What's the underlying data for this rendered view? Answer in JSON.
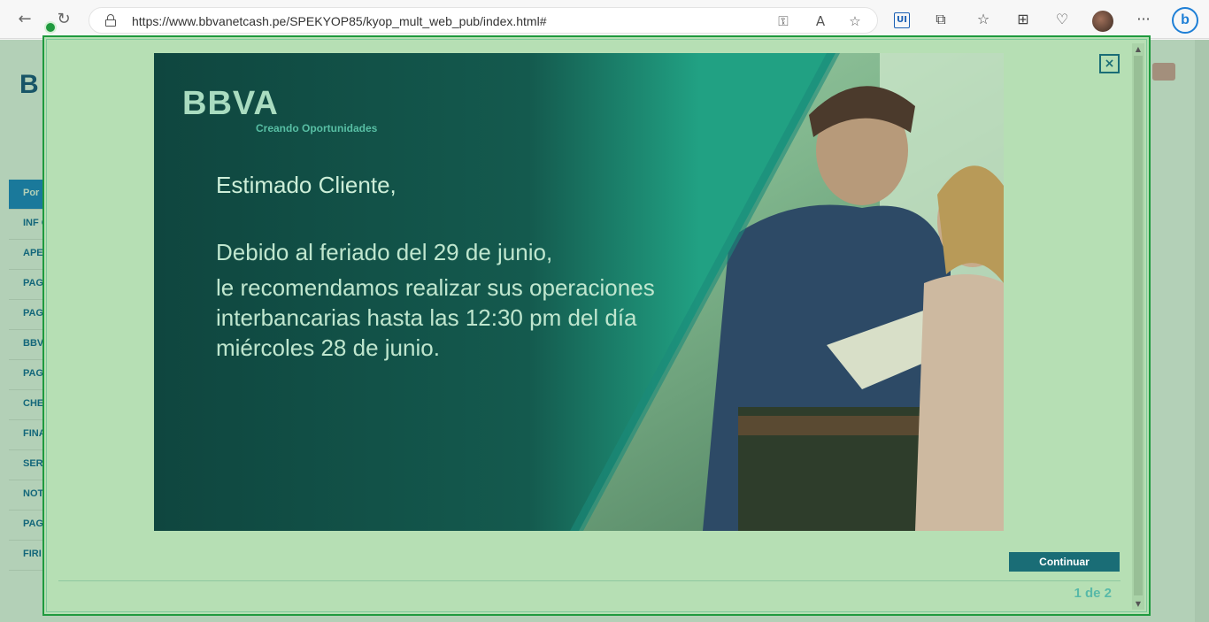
{
  "browser": {
    "url": "https://www.bbvanetcash.pe/SPEKYOP85/kyop_mult_web_pub/index.html#",
    "toolbar_icons": [
      "back-arrow-icon",
      "refresh-icon",
      "lock-icon",
      "key-icon",
      "read-aloud-icon",
      "favorite-star-icon",
      "ui-extension-icon",
      "extensions-icon",
      "favorites-icon",
      "collections-icon",
      "health-icon",
      "profile-avatar",
      "more-icon",
      "bing-icon"
    ],
    "ui_ext_label": "UI",
    "bing_label": "b",
    "more_label": "···",
    "read_aloud_label": "A"
  },
  "background_page": {
    "logo_partial": "B",
    "sidebar_items": [
      "Por",
      "INF CUE",
      "APE",
      "PAG",
      "PAG",
      "BBV",
      "PAG HOM",
      "CHE",
      "FINA",
      "SER",
      "NOT",
      "PAG",
      "FIRI"
    ]
  },
  "modal": {
    "close_label": "×",
    "banner": {
      "brand": "BBVA",
      "tagline": "Creando Oportunidades",
      "greeting": "Estimado Cliente,",
      "message_line1": "Debido al feriado del 29 de junio,",
      "message_lines": "le recomendamos realizar sus operaciones interbancarias hasta las 12:30 pm del día miércoles 28 de junio."
    },
    "continue_label": "Continuar",
    "pager": "1 de 2"
  },
  "colors": {
    "overlay": "#b6dfb4",
    "modal_border": "#1f9a3e",
    "button_teal": "#1a6d76",
    "banner_dark": "#0f463f",
    "pager_text": "#58b9a8"
  }
}
